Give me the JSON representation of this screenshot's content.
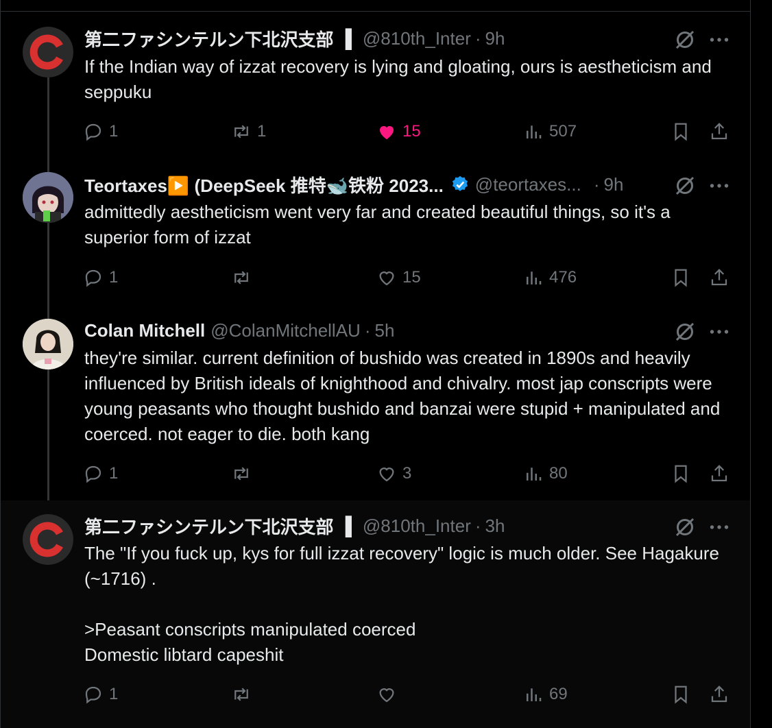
{
  "tweets": [
    {
      "name": "第二ファシンテルン下北沢支部",
      "flag": "▐",
      "handle": "@810th_Inter",
      "time": "9h",
      "text": "If the Indian way of izzat recovery is lying and gloating, ours is aestheticism and seppuku",
      "replies": "1",
      "reposts": "1",
      "likes": "15",
      "liked": true,
      "views": "507"
    },
    {
      "name": "Teortaxes▶️ (DeepSeek 推特🐋铁粉 2023...",
      "handle": "@teortaxes...",
      "time": "9h",
      "verified": true,
      "text": "admittedly aestheticism went very far and created beautiful things, so it's a superior form of izzat",
      "replies": "1",
      "reposts": "",
      "likes": "15",
      "liked": false,
      "views": "476"
    },
    {
      "name": "Colan Mitchell",
      "handle": "@ColanMitchellAU",
      "time": "5h",
      "text": "they're similar. current definition of bushido was created in 1890s and heavily influenced by British ideals of knighthood and chivalry. most jap conscripts were young peasants who thought bushido and banzai were stupid + manipulated and coerced. not eager to die. both kang",
      "replies": "1",
      "reposts": "",
      "likes": "3",
      "liked": false,
      "views": "80"
    },
    {
      "name": "第二ファシンテルン下北沢支部",
      "flag": "▐",
      "handle": "@810th_Inter",
      "time": "3h",
      "text": "The \"If you fuck up, kys for full izzat recovery\" logic is much older. See Hagakure (~1716) .\n\n>Peasant conscripts manipulated coerced\nDomestic libtard capeshit",
      "replies": "1",
      "reposts": "",
      "likes": "",
      "liked": false,
      "views": "69"
    }
  ],
  "icons": {
    "reply": "reply-icon",
    "repost": "repost-icon",
    "like": "heart-icon",
    "views": "views-icon",
    "bookmark": "bookmark-icon",
    "share": "share-icon",
    "grok": "grok-icon",
    "more": "more-icon"
  },
  "colors": {
    "background": "#000000",
    "text": "#e7e9ea",
    "muted": "#71767b",
    "like": "#f91880",
    "verified": "#1d9bf0"
  }
}
